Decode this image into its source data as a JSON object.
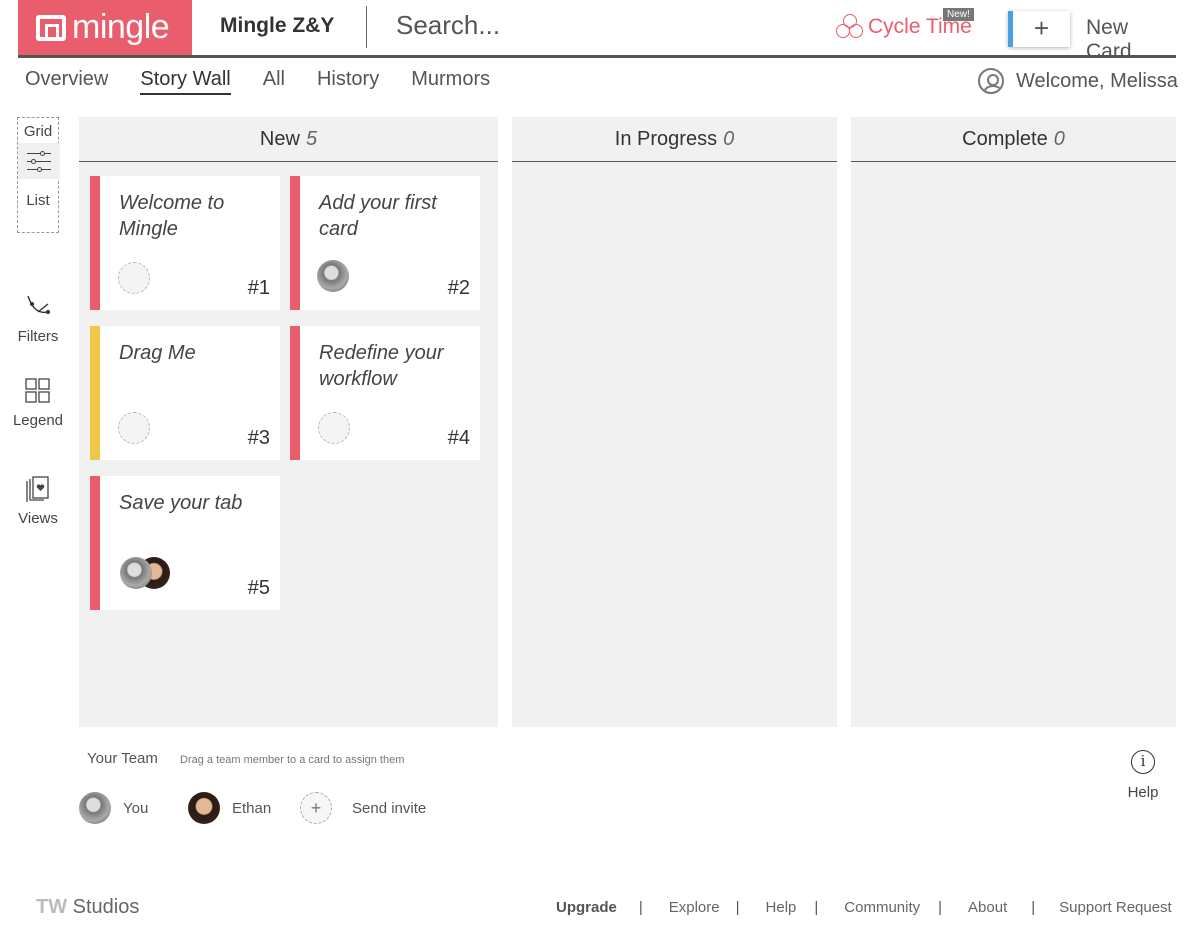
{
  "header": {
    "logo_text": "mingle",
    "project_name": "Mingle Z&Y",
    "search_placeholder": "Search...",
    "cycle_time_label": "Cycle Time",
    "new_badge": "New!",
    "new_card_plus": "+",
    "new_card_label": "New Card"
  },
  "nav": {
    "tabs": [
      {
        "label": "Overview",
        "active": false
      },
      {
        "label": "Story Wall",
        "active": true
      },
      {
        "label": "All",
        "active": false
      },
      {
        "label": "History",
        "active": false
      },
      {
        "label": "Murmors",
        "active": false
      }
    ],
    "welcome": "Welcome, Melissa"
  },
  "toolbar": {
    "grid_label": "Grid",
    "list_label": "List",
    "filters_label": "Filters",
    "legend_label": "Legend",
    "views_label": "Views"
  },
  "columns": [
    {
      "title": "New",
      "count": "5"
    },
    {
      "title": "In Progress",
      "count": "0"
    },
    {
      "title": "Complete",
      "count": "0"
    }
  ],
  "cards": [
    {
      "title": "Welcome to Mingle",
      "number": "#1",
      "color": "#ea5d6c"
    },
    {
      "title": "Add your first card",
      "number": "#2",
      "color": "#ea5d6c"
    },
    {
      "title": "Drag Me",
      "number": "#3",
      "color": "#efc84a"
    },
    {
      "title": "Redefine your workflow",
      "number": "#4",
      "color": "#ea5d6c"
    },
    {
      "title": "Save your tab",
      "number": "#5",
      "color": "#ea5d6c"
    }
  ],
  "team": {
    "title": "Your Team",
    "hint": "Drag a team member to a card to assign them",
    "members": [
      "You",
      "Ethan"
    ],
    "invite_plus": "+",
    "invite_label": "Send invite"
  },
  "help_label": "Help",
  "help_glyph": "i",
  "footer": {
    "brand_prefix": "TW",
    "brand_name": "Studios",
    "links": [
      "Upgrade",
      "Explore",
      "Help",
      "Community",
      "About",
      "Support Request"
    ],
    "separator": "|"
  },
  "colors": {
    "brand": "#ea5d6c",
    "accent_yellow": "#efc84a",
    "new_card_accent": "#4a9fe0",
    "column_bg": "#f1f1f1"
  }
}
